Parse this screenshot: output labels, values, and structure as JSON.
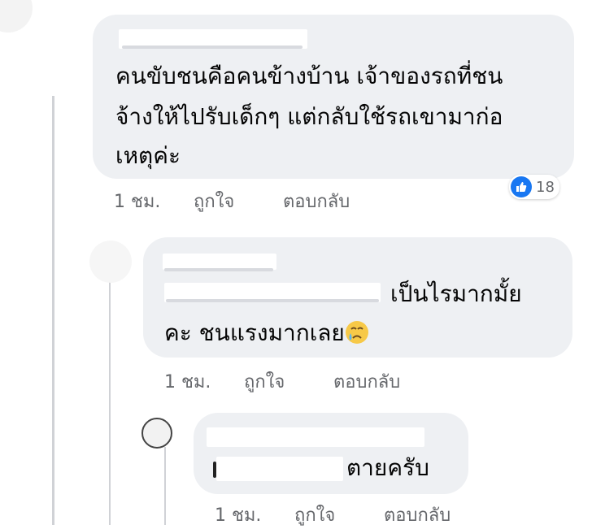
{
  "comments": [
    {
      "text_lines": [
        "คนขับชนคือคนข้างบ้าน เจ้าของรถที่ชน",
        "จ้างให้ไปรับเด็กๆ แต่กลับใช้รถเขามาก่อ",
        "เหตุค่ะ"
      ],
      "time": "1 ชม.",
      "like": "ถูกใจ",
      "reply": "ตอบกลับ",
      "reaction_count": "18",
      "reaction_icon": "like-icon"
    },
    {
      "text_lines": [
        "เป็นไรมากมั้ย",
        "คะ ชนแรงมากเลย"
      ],
      "emoji": "crying-face-emoji",
      "time": "1 ชม.",
      "like": "ถูกใจ",
      "reply": "ตอบกลับ"
    },
    {
      "text_lines": [
        "ตายครับ"
      ],
      "time": "1 ชม.",
      "like": "ถูกใจ",
      "reply": "ตอบกลับ"
    }
  ],
  "colors": {
    "bubble": "#eef0f3",
    "action_text": "#65676b",
    "like_blue": "#1877f2",
    "thread_line": "#d0d2d6"
  }
}
